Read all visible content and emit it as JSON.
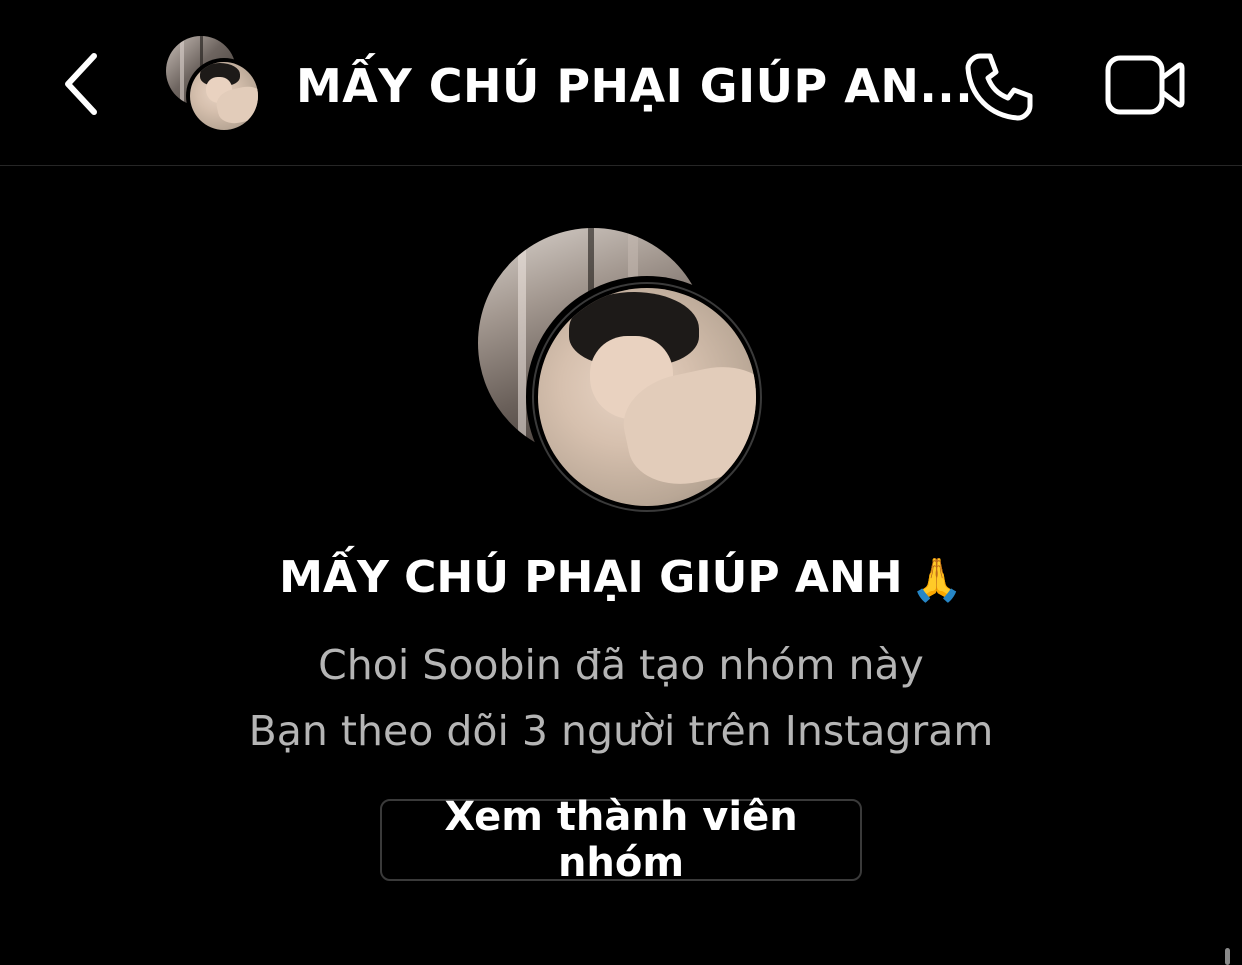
{
  "header": {
    "back_icon": "chevron-left-icon",
    "title": "MẤY CHÚ PHẠI GIÚP AN...",
    "call_icon": "phone-icon",
    "video_icon": "video-camera-icon"
  },
  "group": {
    "name": "MẤY CHÚ PHẠI GIÚP ANH",
    "name_emoji": "🙏",
    "created_by_text": "Choi Soobin đã tạo nhóm này",
    "follow_text": "Bạn theo dõi 3 người trên Instagram",
    "view_members_label": "Xem thành viên nhóm"
  },
  "colors": {
    "background": "#000000",
    "text_primary": "#ffffff",
    "text_secondary": "#b5b5b5",
    "border": "#3a3a3a"
  }
}
